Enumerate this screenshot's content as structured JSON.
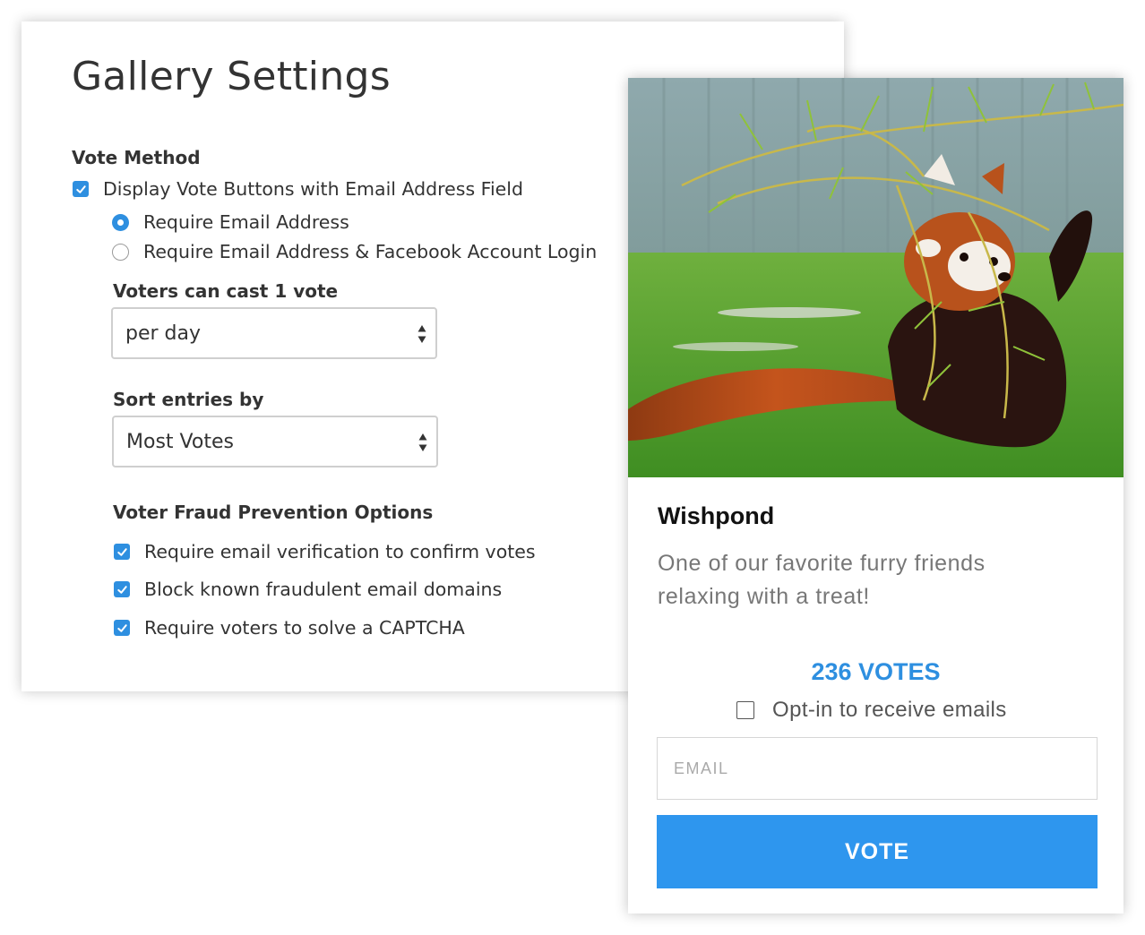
{
  "settings": {
    "title": "Gallery Settings",
    "vote_method": {
      "label": "Vote Method",
      "display_vote_buttons": {
        "label": "Display Vote Buttons with Email Address Field",
        "checked": true
      },
      "options": [
        {
          "label": "Require Email Address",
          "selected": true
        },
        {
          "label": "Require Email Address & Facebook Account Login",
          "selected": false
        }
      ]
    },
    "votes_per": {
      "label": "Voters can cast 1 vote",
      "value": "per day"
    },
    "sort": {
      "label": "Sort entries by",
      "value": "Most Votes"
    },
    "fraud": {
      "label": "Voter Fraud Prevention Options",
      "options": [
        {
          "label": "Require email verification to confirm votes",
          "checked": true
        },
        {
          "label": "Block known fraudulent email domains",
          "checked": true
        },
        {
          "label": "Require voters to solve a CAPTCHA",
          "checked": true
        }
      ]
    }
  },
  "entry": {
    "image_icon": "red-panda-photo",
    "title": "Wishpond",
    "description": "One of our favorite furry friends relaxing with a treat!",
    "votes": "236 VOTES",
    "optin_label": "Opt-in to receive emails",
    "optin_checked": false,
    "email_placeholder": "EMAIL",
    "vote_label": "VOTE"
  },
  "colors": {
    "accent": "#2e8fe0",
    "button": "#2e96ee",
    "text": "#333333",
    "muted": "#777777"
  }
}
